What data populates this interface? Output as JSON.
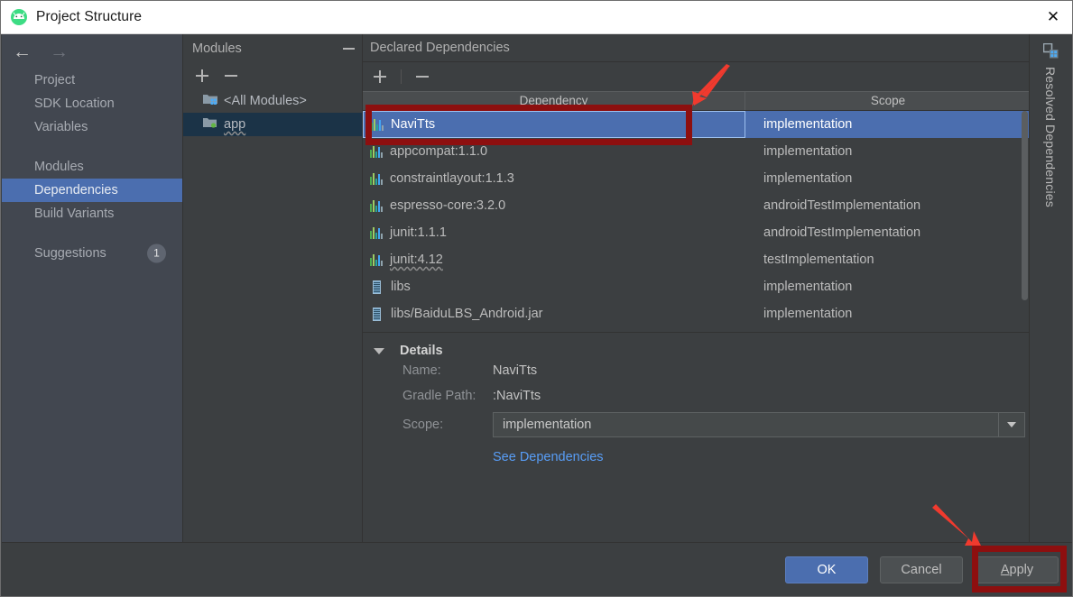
{
  "window": {
    "title": "Project Structure",
    "app_icon": "android-studio-icon",
    "close_label": "✕"
  },
  "sidebar": {
    "back_arrow": "←",
    "forward_arrow": "→",
    "items": [
      {
        "label": "Project",
        "selected": false
      },
      {
        "label": "SDK Location",
        "selected": false
      },
      {
        "label": "Variables",
        "selected": false
      },
      {
        "label": "Modules",
        "selected": false
      },
      {
        "label": "Dependencies",
        "selected": true
      },
      {
        "label": "Build Variants",
        "selected": false
      },
      {
        "label": "Suggestions",
        "selected": false,
        "badge": "1"
      }
    ]
  },
  "modules": {
    "title": "Modules",
    "add_label": "+",
    "remove_label": "−",
    "collapse_label": "−",
    "items": [
      {
        "label": "<All Modules>",
        "selected": false,
        "icon": "modules-folder-icon"
      },
      {
        "label": "app",
        "selected": true,
        "icon": "app-module-icon"
      }
    ]
  },
  "declared_dependencies": {
    "title": "Declared Dependencies",
    "add_label": "+",
    "remove_label": "−",
    "columns": [
      "Dependency",
      "Scope"
    ],
    "rows": [
      {
        "name": "NaviTts",
        "scope": "implementation",
        "icon": "library-icon",
        "selected": true
      },
      {
        "name": "appcompat:1.1.0",
        "scope": "implementation",
        "icon": "library-icon",
        "selected": false
      },
      {
        "name": "constraintlayout:1.1.3",
        "scope": "implementation",
        "icon": "library-icon",
        "selected": false
      },
      {
        "name": "espresso-core:3.2.0",
        "scope": "androidTestImplementation",
        "icon": "library-icon",
        "selected": false
      },
      {
        "name": "junit:1.1.1",
        "scope": "androidTestImplementation",
        "icon": "library-icon",
        "selected": false
      },
      {
        "name": "junit:4.12",
        "scope": "testImplementation",
        "icon": "library-icon",
        "selected": false
      },
      {
        "name": "libs",
        "scope": "implementation",
        "icon": "jar-icon",
        "selected": false
      },
      {
        "name": "libs/BaiduLBS_Android.jar",
        "scope": "implementation",
        "icon": "jar-icon",
        "selected": false
      }
    ]
  },
  "details": {
    "title": "Details",
    "name_label": "Name:",
    "name_value": "NaviTts",
    "gradle_path_label": "Gradle Path:",
    "gradle_path_value": ":NaviTts",
    "scope_label": "Scope:",
    "scope_value": "implementation",
    "see_dependencies_link": "See Dependencies"
  },
  "resolved_dependencies": {
    "label": "Resolved Dependencies",
    "icon": "modules-icon"
  },
  "footer": {
    "ok": "OK",
    "cancel": "Cancel",
    "apply_mnemonic": "A",
    "apply_rest": "pply"
  },
  "annotations": {
    "highlight_color": "#8d0f0f",
    "arrow_color": "#f03a2e"
  }
}
